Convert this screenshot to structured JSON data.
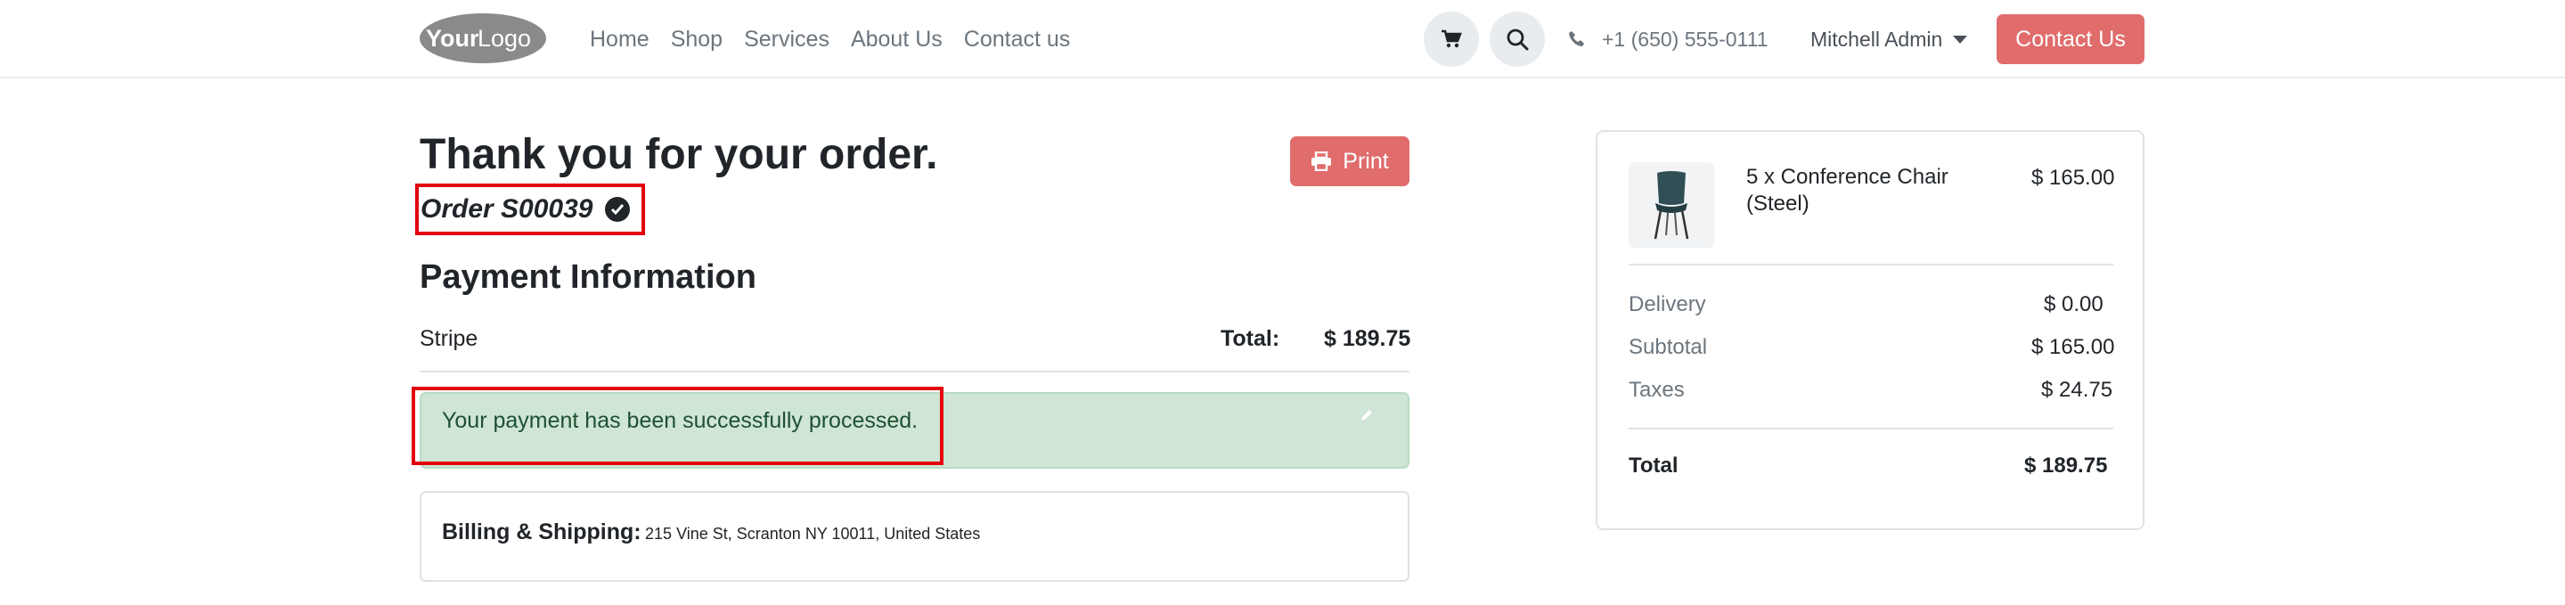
{
  "header": {
    "logo_text_bold": "Your",
    "logo_text_light": "Logo",
    "nav": [
      "Home",
      "Shop",
      "Services",
      "About Us",
      "Contact us"
    ],
    "phone": "+1 (650) 555-0111",
    "user": "Mitchell Admin",
    "contact_button": "Contact Us"
  },
  "order": {
    "title": "Thank you for your order.",
    "print_label": "Print",
    "order_ref": "Order S00039",
    "payment_title": "Payment Information",
    "payment_method": "Stripe",
    "total_label": "Total:",
    "total_value": "$ 189.75",
    "alert_text": "Your payment has been successfully processed.",
    "billing_label": "Billing & Shipping:",
    "billing_address": "215 Vine St, Scranton NY 10011, United States"
  },
  "summary": {
    "product_name": "5 x Conference Chair (Steel)",
    "product_price": "$ 165.00",
    "rows": [
      {
        "label": "Delivery",
        "value": "$ 0.00"
      },
      {
        "label": "Subtotal",
        "value": "$ 165.00"
      },
      {
        "label": "Taxes",
        "value": "$ 24.75"
      }
    ],
    "total_label": "Total",
    "total_value": "$ 189.75"
  },
  "colors": {
    "accent": "#e06c6c",
    "success_bg": "#cfe5d5",
    "success_text": "#1e5132",
    "highlight": "#e3000f"
  },
  "icons": [
    "cart-icon",
    "search-icon",
    "phone-icon",
    "caret-down-icon",
    "print-icon",
    "check-circle-icon",
    "pencil-icon",
    "chair-icon"
  ]
}
